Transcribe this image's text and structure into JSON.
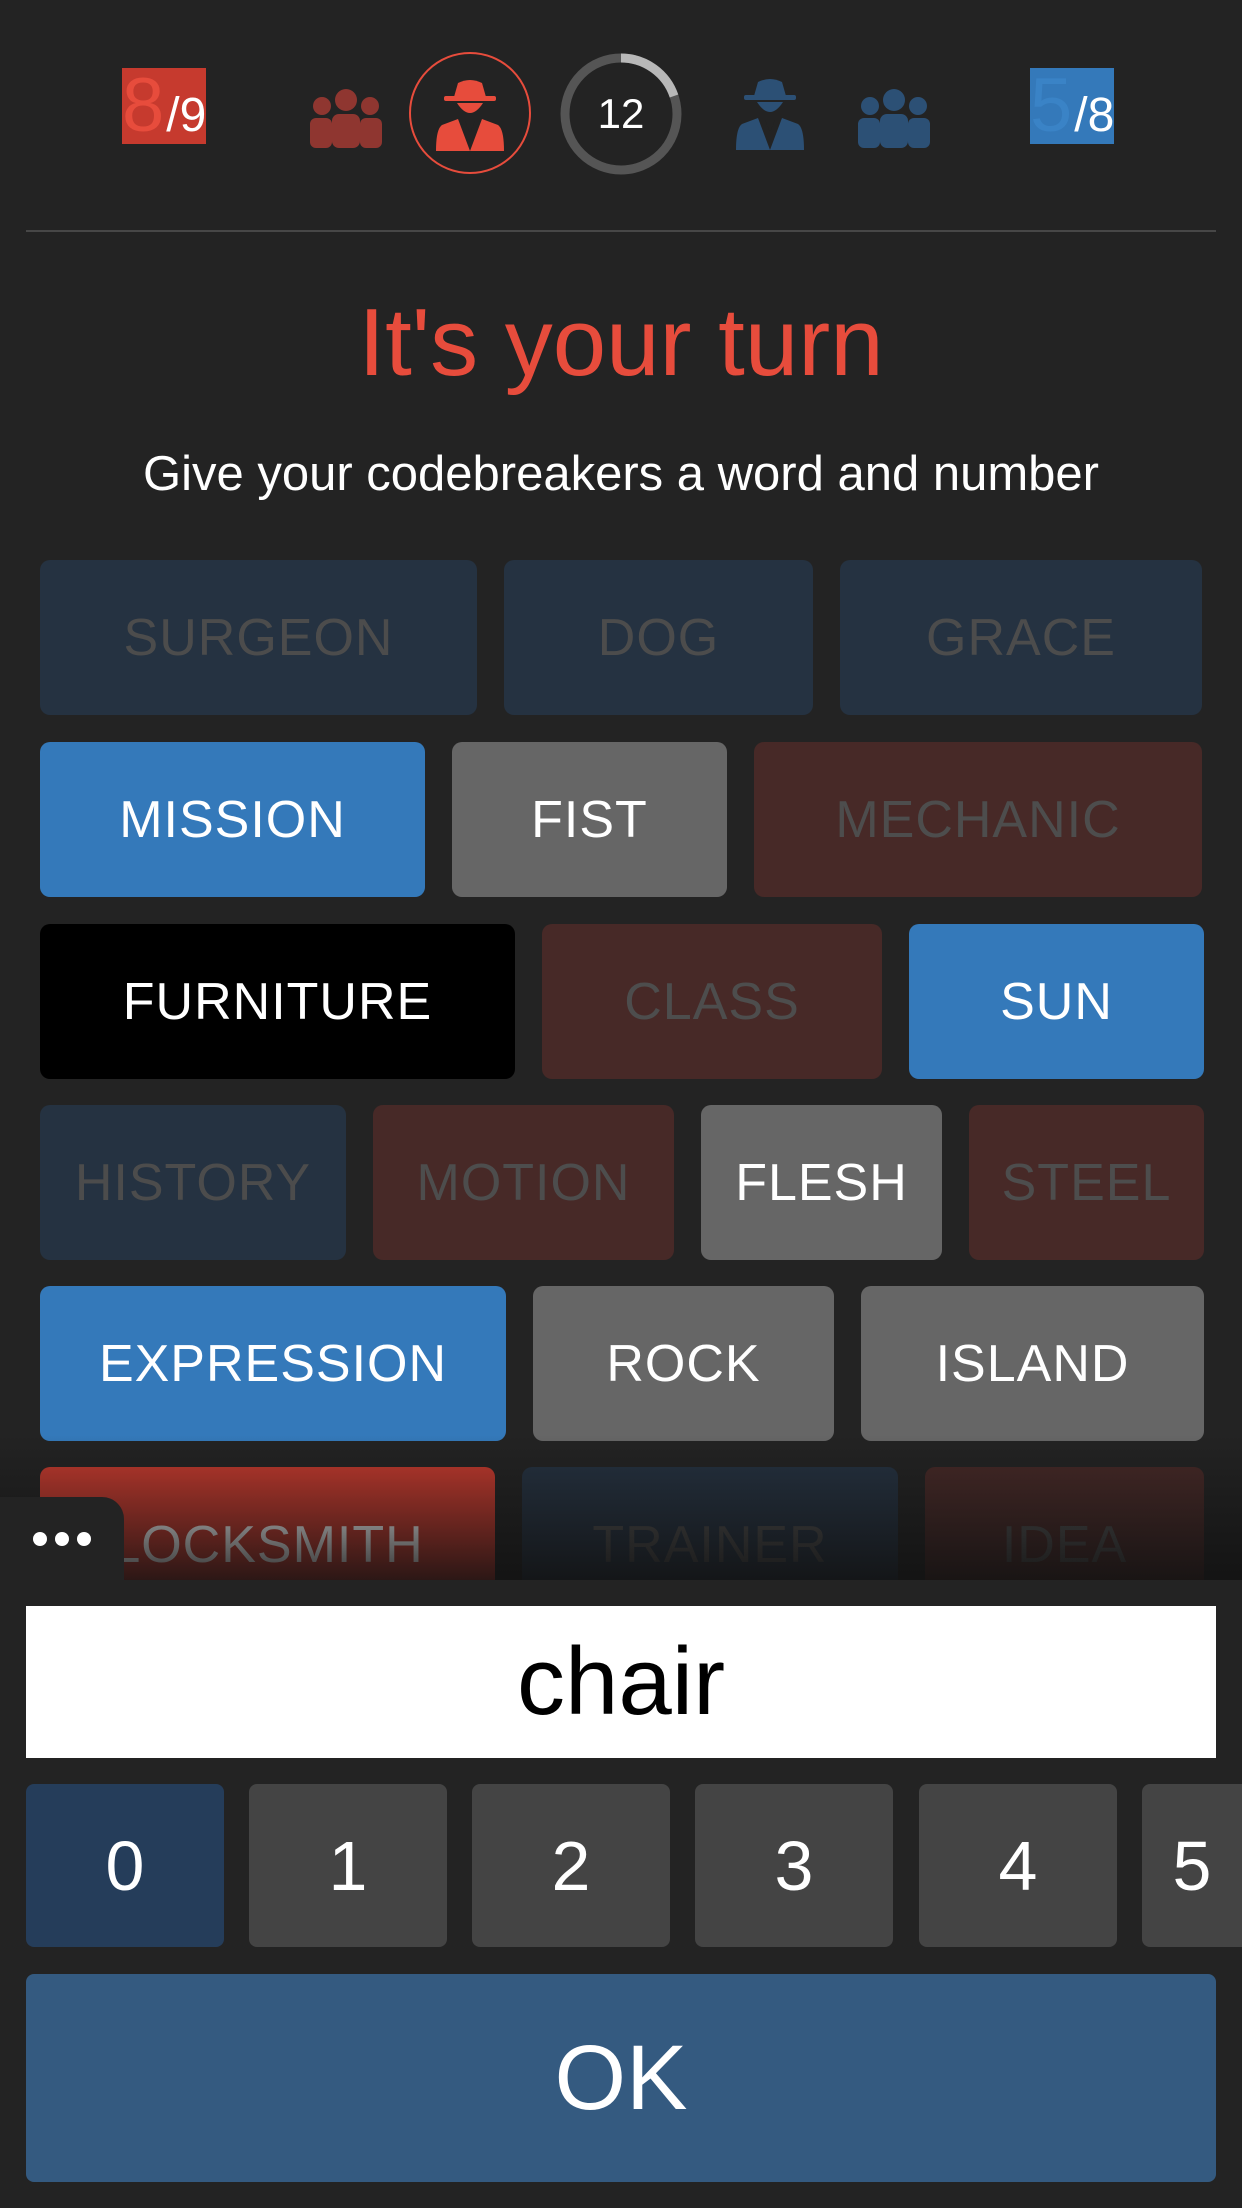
{
  "colors": {
    "red": "#e74c3c",
    "blue": "#3a83c6",
    "background": "#232323"
  },
  "scores": {
    "red": {
      "remaining": "8",
      "total": "/9"
    },
    "blue": {
      "remaining": "5",
      "total": "/8"
    }
  },
  "timer": {
    "value": "12",
    "progress": 0.2
  },
  "icons": [
    "team-red-icon",
    "spymaster-red-icon",
    "timer-ring",
    "spymaster-blue-icon",
    "team-blue-icon",
    "menu-dots-icon"
  ],
  "title": "It's your turn",
  "subtitle": "Give your codebreakers a word and number",
  "cards": [
    {
      "word": "SURGEON",
      "state": "revealed-blue"
    },
    {
      "word": "DOG",
      "state": "revealed-blue"
    },
    {
      "word": "GRACE",
      "state": "revealed-blue"
    },
    {
      "word": "MISSION",
      "state": "blue"
    },
    {
      "word": "FIST",
      "state": "neutral"
    },
    {
      "word": "MECHANIC",
      "state": "revealed-red"
    },
    {
      "word": "FURNITURE",
      "state": "assassin"
    },
    {
      "word": "CLASS",
      "state": "revealed-red"
    },
    {
      "word": "SUN",
      "state": "blue"
    },
    {
      "word": "HISTORY",
      "state": "revealed-blue"
    },
    {
      "word": "MOTION",
      "state": "revealed-red"
    },
    {
      "word": "FLESH",
      "state": "neutral"
    },
    {
      "word": "STEEL",
      "state": "revealed-red"
    },
    {
      "word": "EXPRESSION",
      "state": "blue"
    },
    {
      "word": "ROCK",
      "state": "neutral"
    },
    {
      "word": "ISLAND",
      "state": "neutral"
    },
    {
      "word": "LOCKSMITH",
      "state": "red"
    },
    {
      "word": "TRAINER",
      "state": "revealed-blue"
    },
    {
      "word": "IDEA",
      "state": "revealed-red"
    }
  ],
  "clue": {
    "word": "chair"
  },
  "numbers": [
    "0",
    "1",
    "2",
    "3",
    "4",
    "5"
  ],
  "selected_number": "0",
  "ok_label": "OK"
}
